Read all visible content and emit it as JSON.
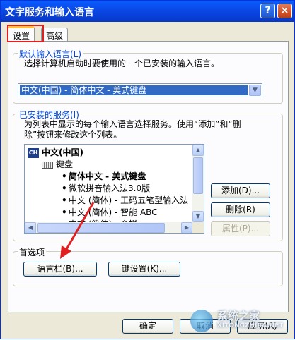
{
  "window": {
    "title": "文字服务和输入语言",
    "help": "?",
    "close": "×"
  },
  "tabs": [
    {
      "label": "设置"
    },
    {
      "label": "高级"
    }
  ],
  "default_language": {
    "group_label": "默认输入语言(L)",
    "description": "选择计算机启动时要使用的一个已安装的输入语言。",
    "selected": "中文(中国) - 简体中文 - 美式键盘"
  },
  "installed_services": {
    "group_label": "已安装的服务(I)",
    "description_line1": "为列表中显示的每个输入语言选择服务。使用“添加”和“删",
    "description_line2": "除”按钮来修改这个列表。",
    "items": [
      {
        "badge": "CH",
        "label": "中文(中国)"
      },
      {
        "label": "键盘"
      },
      {
        "label": "简体中文 - 美式键盘"
      },
      {
        "label": "微软拼音输入法3.0版"
      },
      {
        "label": "中文 (简体) - 王码五笔型输入法"
      },
      {
        "label": "中文 (简体) - 智能 ABC"
      },
      {
        "label": "中文 (简体) - 全拼"
      }
    ]
  },
  "buttons": {
    "add": "添加(D)...",
    "remove": "删除(R)",
    "properties": "属性(P)..."
  },
  "preferences": {
    "group_label": "首选项",
    "language_bar": "语言栏(B)...",
    "key_settings": "键设置(K)..."
  },
  "footer": {
    "ok": "确定",
    "cancel": "取消",
    "apply": "应用(A)"
  },
  "watermark": {
    "line1": "系统之家",
    "line2": "XITONGZHIJIA.NET"
  },
  "colors": {
    "titlebar": "#0a48e6",
    "group_label": "#0046d5",
    "selection": "#316ac5",
    "annotation": "#e02020"
  }
}
